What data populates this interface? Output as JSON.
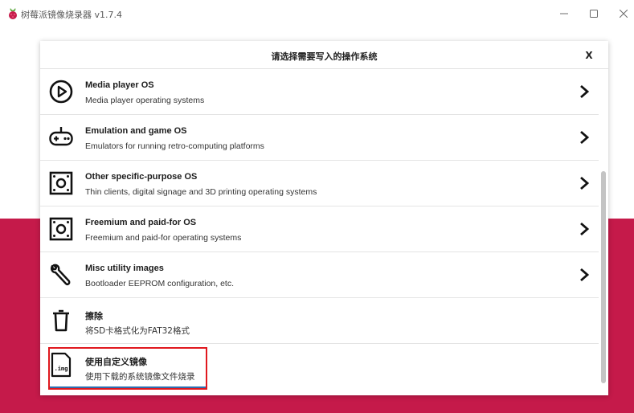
{
  "window": {
    "title": "树莓派镜像烧录器 v1.7.4",
    "controls": {
      "minimize": "—",
      "maximize": "☐",
      "close": "✕"
    }
  },
  "dialog": {
    "title": "请选择需要写入的操作系统",
    "close_label": "X",
    "items": [
      {
        "icon": "play-circle-icon",
        "name": "Media player OS",
        "desc": "Media player operating systems",
        "has_chevron": true
      },
      {
        "icon": "gamepad-icon",
        "name": "Emulation and game OS",
        "desc": "Emulators for running retro-computing platforms",
        "has_chevron": true
      },
      {
        "icon": "board-icon",
        "name": "Other specific-purpose OS",
        "desc": "Thin clients, digital signage and 3D printing operating systems",
        "has_chevron": true
      },
      {
        "icon": "board-icon",
        "name": "Freemium and paid-for OS",
        "desc": "Freemium and paid-for operating systems",
        "has_chevron": true
      },
      {
        "icon": "wrench-icon",
        "name": "Misc utility images",
        "desc": "Bootloader EEPROM configuration, etc.",
        "has_chevron": true
      },
      {
        "icon": "trash-icon",
        "name": "擦除",
        "desc": "将SD卡格式化为FAT32格式",
        "has_chevron": false
      },
      {
        "icon": "img-file-icon",
        "icon_label": ".img",
        "name": "使用自定义镜像",
        "desc": "使用下载的系统镜像文件烧录",
        "has_chevron": false
      }
    ]
  },
  "colors": {
    "brand_red": "#c51a4a",
    "highlight_red": "#e0181e",
    "selection_blue": "#2d6fb0"
  }
}
